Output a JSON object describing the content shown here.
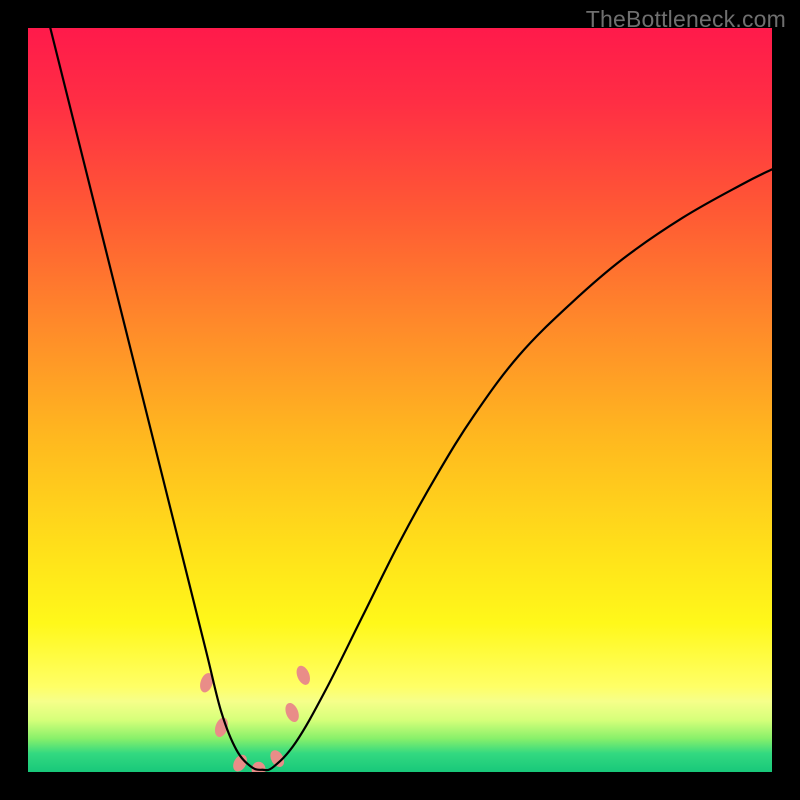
{
  "watermark": "TheBottleneck.com",
  "chart_data": {
    "type": "line",
    "title": "",
    "xlabel": "",
    "ylabel": "",
    "xlim": [
      0,
      100
    ],
    "ylim": [
      0,
      100
    ],
    "axes_visible": false,
    "gradient_stops": [
      {
        "offset": 0.0,
        "color": "#ff1a4b"
      },
      {
        "offset": 0.1,
        "color": "#ff2e44"
      },
      {
        "offset": 0.25,
        "color": "#ff5a34"
      },
      {
        "offset": 0.4,
        "color": "#ff8a2a"
      },
      {
        "offset": 0.55,
        "color": "#ffb81f"
      },
      {
        "offset": 0.7,
        "color": "#ffe01a"
      },
      {
        "offset": 0.8,
        "color": "#fff81a"
      },
      {
        "offset": 0.885,
        "color": "#ffff66"
      },
      {
        "offset": 0.905,
        "color": "#f6ff8a"
      },
      {
        "offset": 0.93,
        "color": "#d6ff7a"
      },
      {
        "offset": 0.955,
        "color": "#88f06a"
      },
      {
        "offset": 0.975,
        "color": "#33d980"
      },
      {
        "offset": 1.0,
        "color": "#18c87a"
      }
    ],
    "series": [
      {
        "name": "bottleneck-curve",
        "color": "#000000",
        "width": 2.2,
        "x": [
          3,
          6,
          9,
          12,
          15,
          18,
          21,
          24,
          26,
          28,
          30,
          31.5,
          33,
          36,
          40,
          45,
          50,
          55,
          60,
          66,
          73,
          80,
          88,
          96,
          100
        ],
        "y": [
          100,
          88,
          76,
          64,
          52,
          40,
          28,
          16,
          8,
          3,
          0.7,
          0.3,
          0.7,
          4,
          11,
          21,
          31,
          40,
          48,
          56,
          63,
          69,
          74.5,
          79,
          81
        ]
      }
    ],
    "markers": [
      {
        "name": "mk1",
        "x": 24.0,
        "y": 12.0,
        "color": "#e98d88",
        "rx": 6,
        "ry": 10,
        "rot": 18
      },
      {
        "name": "mk2",
        "x": 26.0,
        "y": 6.0,
        "color": "#e98d88",
        "rx": 6,
        "ry": 10,
        "rot": 18
      },
      {
        "name": "mk3",
        "x": 28.5,
        "y": 1.2,
        "color": "#e98d88",
        "rx": 6,
        "ry": 9,
        "rot": 30
      },
      {
        "name": "mk4",
        "x": 31.0,
        "y": 0.3,
        "color": "#e98d88",
        "rx": 7,
        "ry": 8,
        "rot": 0
      },
      {
        "name": "mk5",
        "x": 33.5,
        "y": 1.8,
        "color": "#e98d88",
        "rx": 6,
        "ry": 9,
        "rot": -30
      },
      {
        "name": "mk6",
        "x": 35.5,
        "y": 8.0,
        "color": "#e98d88",
        "rx": 6,
        "ry": 10,
        "rot": -22
      },
      {
        "name": "mk7",
        "x": 37.0,
        "y": 13.0,
        "color": "#e98d88",
        "rx": 6,
        "ry": 10,
        "rot": -22
      }
    ]
  }
}
